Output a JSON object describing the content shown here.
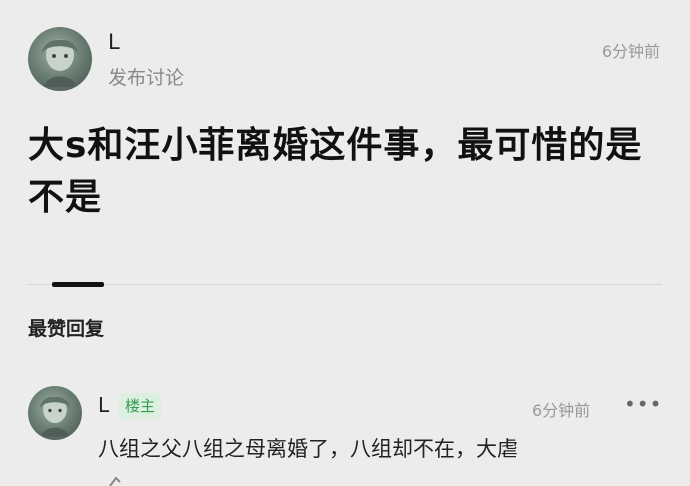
{
  "post": {
    "username": "L",
    "subtitle": "发布讨论",
    "time": "6分钟前",
    "title": "大s和汪小菲离婚这件事，最可惜的是不是"
  },
  "tabs": {
    "active_label": "最赞回复"
  },
  "reply": {
    "username": "L",
    "badge": "楼主",
    "time": "6分钟前",
    "more": "•••",
    "text": "八组之父八组之母离婚了，八组却不在，大虐"
  },
  "colors": {
    "background": "#ececec",
    "badge_text": "#2f9e4f",
    "badge_bg": "#dcefe0"
  },
  "icons": {
    "avatar": "anime-avatar",
    "more": "more-dots-icon"
  }
}
